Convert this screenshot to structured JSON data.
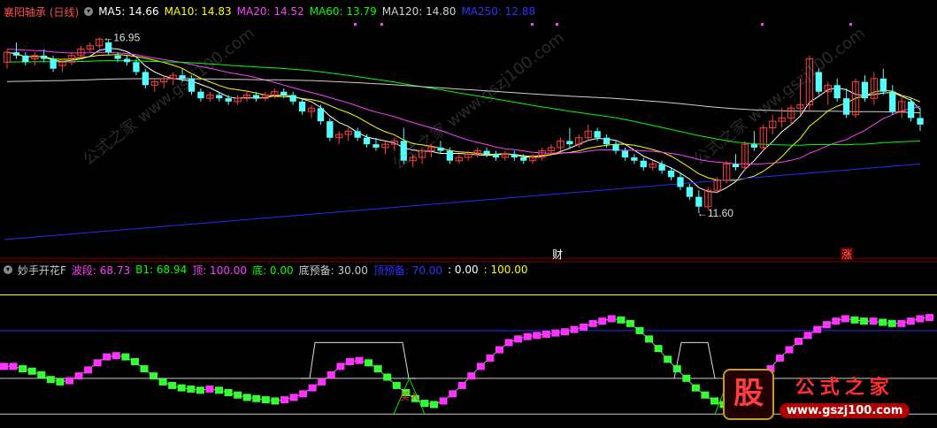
{
  "colors": {
    "bg": "#000000",
    "up_candle": "#ff4040",
    "down_candle": "#54ffff",
    "ma5": "#ffffff",
    "ma10": "#ffff00",
    "ma20": "#ff40ff",
    "ma60": "#00ff00",
    "ma120": "#d0d0d0",
    "ma250": "#2a2aff",
    "grid": "#800000",
    "rise": "#ff33ff",
    "fall": "#33ff33"
  },
  "top_header": {
    "stock": "襄阳轴承 (日线)",
    "ma5": "MA5: 14.66",
    "ma10": "MA10: 14.83",
    "ma20": "MA20: 14.52",
    "ma60": "MA60: 13.79",
    "ma120": "MA120: 14.80",
    "ma250": "MA250: 12.88"
  },
  "bottom_header": {
    "name": "妙手开花F",
    "bd": "波段: 68.73",
    "b1": "B1: 68.94",
    "ding": "顶: 100.00",
    "di": "底: 0.00",
    "dyb": "底预备: 30.00",
    "dingyb": "顶预备: 70.00",
    "v1": ": 0.00",
    "v2": ": 100.00"
  },
  "markers": {
    "high_label": "16.95",
    "low_label": "11.60",
    "cai": "财",
    "zhang": "涨",
    "buy": "买入"
  },
  "watermark": {
    "logo": "股",
    "name": "公式之家",
    "url": "www.gszj100.com",
    "diag": "公式之家 www.gszj100.com"
  },
  "chart_data": [
    {
      "type": "candlestick",
      "title": "襄阳轴承 (日线)",
      "ylim": [
        10.5,
        17.5
      ],
      "candles": [
        [
          16.2,
          16.6,
          16.0,
          16.5
        ],
        [
          16.5,
          16.8,
          16.3,
          16.4
        ],
        [
          16.4,
          16.5,
          16.1,
          16.2
        ],
        [
          16.3,
          16.5,
          16.1,
          16.4
        ],
        [
          16.4,
          16.6,
          16.2,
          16.3
        ],
        [
          16.3,
          16.4,
          15.9,
          16.0
        ],
        [
          16.1,
          16.3,
          15.9,
          16.2
        ],
        [
          16.2,
          16.5,
          16.1,
          16.4
        ],
        [
          16.4,
          16.7,
          16.3,
          16.6
        ],
        [
          16.6,
          16.8,
          16.5,
          16.7
        ],
        [
          16.7,
          16.95,
          16.6,
          16.9
        ],
        [
          16.8,
          16.9,
          16.4,
          16.5
        ],
        [
          16.4,
          16.5,
          16.2,
          16.3
        ],
        [
          16.3,
          16.4,
          16.1,
          16.2
        ],
        [
          16.2,
          16.3,
          15.8,
          15.9
        ],
        [
          15.9,
          16.0,
          15.4,
          15.5
        ],
        [
          15.5,
          15.7,
          15.3,
          15.6
        ],
        [
          15.6,
          15.8,
          15.4,
          15.7
        ],
        [
          15.7,
          15.9,
          15.5,
          15.8
        ],
        [
          15.8,
          16.0,
          15.6,
          15.7
        ],
        [
          15.7,
          15.8,
          15.2,
          15.3
        ],
        [
          15.3,
          15.4,
          15.0,
          15.1
        ],
        [
          15.1,
          15.3,
          15.0,
          15.2
        ],
        [
          15.2,
          15.3,
          15.0,
          15.1
        ],
        [
          15.1,
          15.2,
          14.9,
          15.0
        ],
        [
          15.0,
          15.2,
          14.9,
          15.1
        ],
        [
          15.1,
          15.3,
          15.0,
          15.2
        ],
        [
          15.2,
          15.3,
          15.0,
          15.1
        ],
        [
          15.1,
          15.3,
          15.0,
          15.2
        ],
        [
          15.2,
          15.4,
          15.1,
          15.3
        ],
        [
          15.3,
          15.4,
          15.1,
          15.2
        ],
        [
          15.2,
          15.3,
          14.9,
          15.0
        ],
        [
          15.0,
          15.1,
          14.6,
          14.7
        ],
        [
          14.7,
          14.9,
          14.5,
          14.8
        ],
        [
          14.8,
          14.9,
          14.3,
          14.4
        ],
        [
          14.4,
          14.5,
          13.8,
          13.9
        ],
        [
          13.9,
          14.1,
          13.7,
          14.0
        ],
        [
          14.0,
          14.2,
          13.8,
          14.1
        ],
        [
          14.1,
          14.2,
          13.8,
          13.9
        ],
        [
          13.9,
          14.0,
          13.6,
          13.7
        ],
        [
          13.7,
          13.9,
          13.5,
          13.6
        ],
        [
          13.6,
          13.8,
          13.4,
          13.7
        ],
        [
          13.7,
          13.9,
          13.5,
          13.8
        ],
        [
          13.8,
          14.2,
          13.1,
          13.2
        ],
        [
          13.2,
          13.4,
          13.0,
          13.3
        ],
        [
          13.3,
          13.6,
          13.1,
          13.5
        ],
        [
          13.5,
          13.7,
          13.3,
          13.6
        ],
        [
          13.6,
          13.8,
          13.4,
          13.5
        ],
        [
          13.5,
          13.6,
          13.1,
          13.2
        ],
        [
          13.2,
          13.4,
          13.1,
          13.3
        ],
        [
          13.3,
          13.5,
          13.2,
          13.4
        ],
        [
          13.4,
          13.6,
          13.3,
          13.5
        ],
        [
          13.5,
          13.6,
          13.3,
          13.4
        ],
        [
          13.4,
          13.5,
          13.2,
          13.3
        ],
        [
          13.3,
          13.5,
          13.2,
          13.4
        ],
        [
          13.4,
          13.5,
          13.2,
          13.3
        ],
        [
          13.3,
          13.4,
          13.1,
          13.2
        ],
        [
          13.2,
          13.4,
          13.1,
          13.3
        ],
        [
          13.3,
          13.6,
          13.2,
          13.5
        ],
        [
          13.5,
          13.7,
          13.4,
          13.6
        ],
        [
          13.6,
          13.9,
          13.5,
          13.8
        ],
        [
          13.8,
          14.2,
          13.6,
          13.7
        ],
        [
          13.7,
          14.0,
          13.6,
          13.9
        ],
        [
          13.9,
          14.3,
          13.8,
          14.1
        ],
        [
          14.1,
          14.2,
          13.8,
          13.9
        ],
        [
          13.9,
          14.0,
          13.6,
          13.7
        ],
        [
          13.7,
          13.8,
          13.4,
          13.5
        ],
        [
          13.5,
          13.6,
          13.2,
          13.3
        ],
        [
          13.3,
          13.4,
          13.1,
          13.2
        ],
        [
          13.2,
          13.3,
          12.9,
          13.0
        ],
        [
          13.0,
          13.2,
          12.9,
          13.1
        ],
        [
          13.1,
          13.2,
          12.8,
          12.9
        ],
        [
          12.9,
          13.0,
          12.6,
          12.7
        ],
        [
          12.7,
          12.8,
          12.3,
          12.4
        ],
        [
          12.4,
          12.5,
          12.0,
          12.1
        ],
        [
          12.1,
          12.3,
          11.6,
          11.8
        ],
        [
          11.8,
          12.4,
          11.7,
          12.3
        ],
        [
          12.3,
          12.7,
          12.2,
          12.6
        ],
        [
          12.6,
          13.2,
          12.5,
          13.1
        ],
        [
          13.1,
          13.4,
          12.9,
          13.0
        ],
        [
          13.0,
          13.8,
          12.9,
          13.7
        ],
        [
          13.7,
          14.1,
          13.5,
          13.6
        ],
        [
          13.6,
          14.3,
          13.5,
          14.2
        ],
        [
          14.2,
          14.6,
          14.0,
          14.4
        ],
        [
          14.4,
          14.8,
          14.2,
          14.5
        ],
        [
          14.5,
          14.9,
          14.3,
          14.8
        ],
        [
          14.8,
          15.7,
          14.6,
          14.9
        ],
        [
          14.9,
          16.4,
          14.7,
          16.3
        ],
        [
          15.9,
          16.0,
          15.2,
          15.3
        ],
        [
          15.3,
          15.6,
          14.9,
          15.5
        ],
        [
          15.5,
          15.7,
          15.0,
          15.1
        ],
        [
          15.1,
          15.4,
          14.5,
          14.6
        ],
        [
          14.6,
          15.7,
          14.5,
          15.6
        ],
        [
          15.6,
          15.8,
          15.0,
          15.1
        ],
        [
          15.1,
          15.9,
          14.9,
          15.7
        ],
        [
          15.7,
          16.0,
          15.2,
          15.3
        ],
        [
          15.3,
          15.5,
          14.6,
          14.7
        ],
        [
          14.7,
          15.2,
          14.5,
          15.0
        ],
        [
          15.0,
          15.1,
          14.4,
          14.5
        ],
        [
          14.5,
          14.8,
          14.1,
          14.3
        ]
      ],
      "high_mark": 16.95,
      "low_mark": 11.6
    },
    {
      "type": "line",
      "title": "妙手开花F",
      "ylim": [
        -5,
        110
      ],
      "series": [
        {
          "name": "波段",
          "values": [
            40,
            40,
            38,
            36,
            33,
            29,
            27,
            28,
            32,
            37,
            43,
            48,
            49,
            48,
            44,
            38,
            32,
            27,
            24,
            22,
            21,
            20,
            21,
            20,
            18,
            16,
            14,
            13,
            12,
            11,
            12,
            14,
            17,
            22,
            27,
            33,
            40,
            44,
            45,
            43,
            38,
            31,
            24,
            18,
            13,
            9,
            8,
            11,
            17,
            24,
            32,
            40,
            47,
            54,
            60,
            63,
            65,
            66,
            67,
            68,
            69,
            71,
            73,
            76,
            78,
            80,
            79,
            76,
            70,
            63,
            55,
            46,
            38,
            30,
            22,
            16,
            11,
            8,
            6,
            5,
            18,
            28,
            38,
            47,
            54,
            61,
            66,
            71,
            75,
            78,
            80,
            79,
            78,
            78,
            77,
            76,
            76,
            78,
            80,
            81
          ]
        }
      ],
      "lines": {
        "顶预备": 70,
        "底预备": 30,
        "顶": 100,
        "底": 0
      }
    }
  ]
}
